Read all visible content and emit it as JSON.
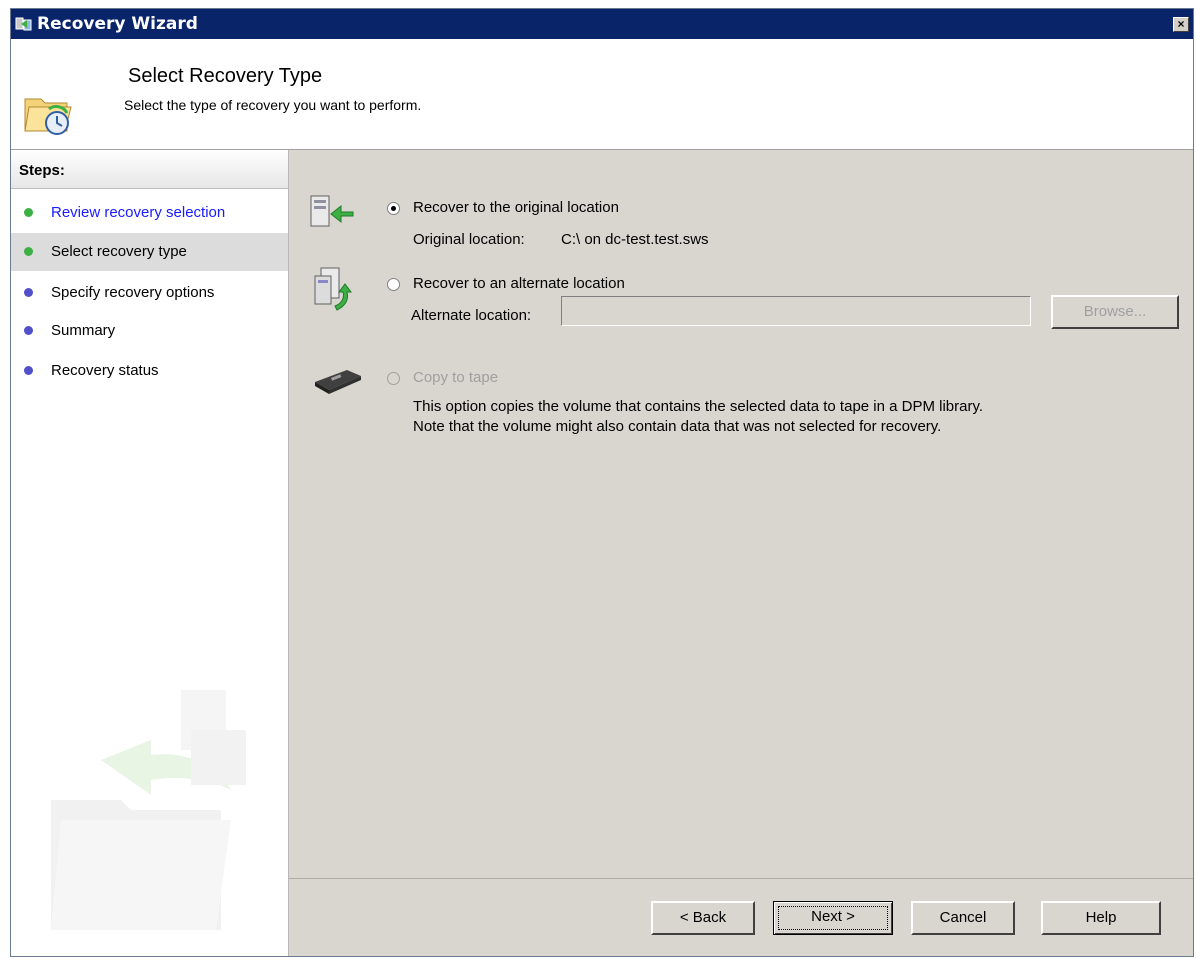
{
  "window": {
    "title": "Recovery Wizard",
    "close_label": "×"
  },
  "header": {
    "title": "Select Recovery Type",
    "subtitle": "Select the type of recovery you want to perform."
  },
  "steps": {
    "heading": "Steps:",
    "items": [
      {
        "label": "Review recovery selection",
        "state": "link",
        "dot_color": "#3cb043"
      },
      {
        "label": "Select recovery type",
        "state": "active",
        "dot_color": "#3cb043"
      },
      {
        "label": "Specify recovery options",
        "state": "pending",
        "dot_color": "#5050c8"
      },
      {
        "label": "Summary",
        "state": "pending",
        "dot_color": "#5050c8"
      },
      {
        "label": "Recovery status",
        "state": "pending",
        "dot_color": "#5050c8"
      }
    ]
  },
  "options": {
    "original": {
      "label": "Recover to the original location",
      "selected": true,
      "detail_label": "Original location:",
      "detail_value": "C:\\ on dc-test.test.sws"
    },
    "alternate": {
      "label": "Recover to an alternate location",
      "selected": false,
      "field_label": "Alternate location:",
      "field_value": "",
      "browse_label": "Browse..."
    },
    "tape": {
      "label": "Copy to tape",
      "selected": false,
      "enabled": false,
      "description_line1": "This option copies the volume that contains the selected data to tape in a DPM library.",
      "description_line2": "Note that the volume might also contain data that was not selected for recovery."
    }
  },
  "buttons": {
    "back": "< Back",
    "next": "Next >",
    "cancel": "Cancel",
    "help": "Help"
  }
}
